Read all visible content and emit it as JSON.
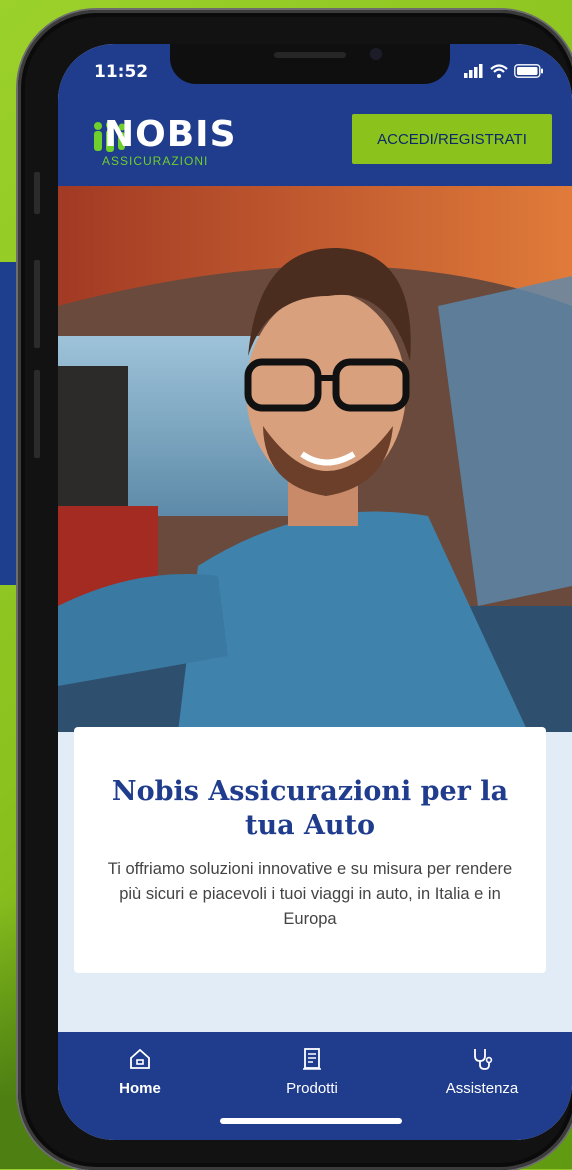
{
  "status": {
    "time": "11:52"
  },
  "header": {
    "logo_word": "NOBIS",
    "logo_sub": "ASSICURAZIONI",
    "login_label": "ACCEDI/REGISTRATI"
  },
  "categories": [
    {
      "icon": "car-shield-icon",
      "active": true
    },
    {
      "icon": "plane-icon",
      "active": false
    },
    {
      "icon": "home-hand-icon",
      "active": false
    },
    {
      "icon": "heart-pulse-icon",
      "active": false
    },
    {
      "icon": "building-icon",
      "active": false
    }
  ],
  "card": {
    "title": "Nobis Assicurazioni per la tua Auto",
    "description": "Ti offriamo soluzioni innovative e su misura per rendere più sicuri e piacevoli i tuoi viaggi in auto, in Italia e in Europa"
  },
  "tabbar": {
    "items": [
      {
        "label": "Home",
        "icon": "home-icon",
        "active": true
      },
      {
        "label": "Prodotti",
        "icon": "document-icon",
        "active": false
      },
      {
        "label": "Assistenza",
        "icon": "stethoscope-icon",
        "active": false
      }
    ]
  },
  "colors": {
    "brand_blue": "#1f3c8d",
    "brand_green": "#8bc21c"
  }
}
